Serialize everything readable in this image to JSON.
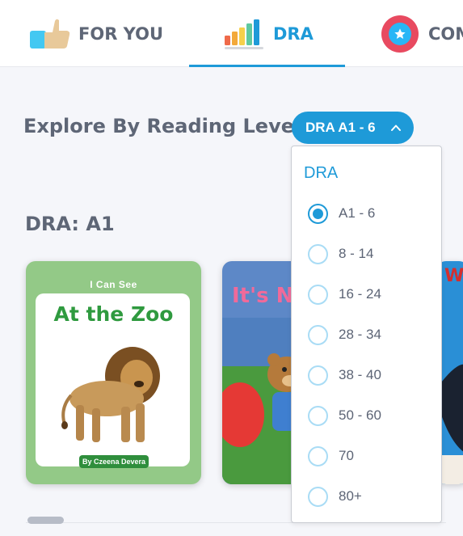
{
  "tabs": [
    {
      "label": "FOR YOU",
      "icon": "thumbs-up-icon",
      "active": false
    },
    {
      "label": "DRA",
      "icon": "bar-chart-icon",
      "active": true
    },
    {
      "label": "COM",
      "icon": "star-badge-icon",
      "active": false
    }
  ],
  "explore": {
    "label": "Explore By Reading Level:",
    "selected_level": "DRA A1 - 6"
  },
  "section": {
    "title": "DRA: A1"
  },
  "books": [
    {
      "series": "I Can See",
      "title": "At the Zoo",
      "author": "By Czeena Devera"
    },
    {
      "title": "It's N"
    },
    {
      "title": "W"
    }
  ],
  "dropdown": {
    "header": "DRA",
    "selected_index": 0,
    "options": [
      "A1 - 6",
      "8 - 14",
      "16 - 24",
      "28 - 34",
      "38 - 40",
      "50 - 60",
      "70",
      "80+"
    ]
  },
  "colors": {
    "accent": "#1e9ad8",
    "text": "#5e6676",
    "book1_bg": "#93c987",
    "book1_title": "#2f9a3f"
  }
}
